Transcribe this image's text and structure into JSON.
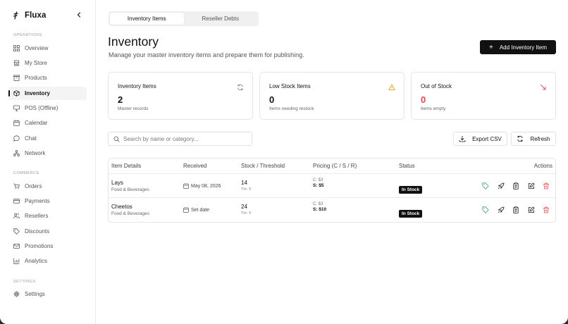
{
  "app": {
    "name": "Fluxa"
  },
  "sidebar": {
    "sections": [
      {
        "label": "OPERATIONS",
        "items": [
          {
            "label": "Overview",
            "icon": "grid-icon"
          },
          {
            "label": "My Store",
            "icon": "store-icon"
          },
          {
            "label": "Products",
            "icon": "box-icon"
          },
          {
            "label": "Inventory",
            "icon": "package-icon",
            "active": true
          },
          {
            "label": "POS (Offline)",
            "icon": "monitor-icon"
          },
          {
            "label": "Calendar",
            "icon": "calendar-icon"
          },
          {
            "label": "Chat",
            "icon": "chat-icon"
          },
          {
            "label": "Network",
            "icon": "network-icon"
          }
        ]
      },
      {
        "label": "COMMERCE",
        "items": [
          {
            "label": "Orders",
            "icon": "cart-icon"
          },
          {
            "label": "Payments",
            "icon": "card-icon"
          },
          {
            "label": "Resellers",
            "icon": "users-icon"
          },
          {
            "label": "Discounts",
            "icon": "tag-icon"
          },
          {
            "label": "Promotions",
            "icon": "mail-icon"
          },
          {
            "label": "Analytics",
            "icon": "chart-icon"
          }
        ]
      },
      {
        "label": "SETTINGS",
        "items": [
          {
            "label": "Settings",
            "icon": "gear-icon"
          }
        ]
      }
    ]
  },
  "tabs": [
    {
      "label": "Inventory Items",
      "active": true
    },
    {
      "label": "Reseller Debts",
      "active": false
    }
  ],
  "header": {
    "title": "Inventory",
    "subtitle": "Manage your master inventory items and prepare them for publishing.",
    "add_button": "Add Inventory Item"
  },
  "stats": [
    {
      "title": "Inventory Items",
      "value": "2",
      "caption": "Master records",
      "icon": "refresh-icon",
      "value_color": "#111111"
    },
    {
      "title": "Low Stock Items",
      "value": "0",
      "caption": "Items needing restock",
      "icon": "warning-icon",
      "value_color": "#111111"
    },
    {
      "title": "Out of Stock",
      "value": "0",
      "caption": "Items empty",
      "icon": "trend-down-icon",
      "value_color": "#e5484d"
    }
  ],
  "toolbar": {
    "search_placeholder": "Search by name or category...",
    "export_label": "Export CSV",
    "refresh_label": "Refresh"
  },
  "table": {
    "columns": [
      "Item Details",
      "Received",
      "Stock / Threshold",
      "Pricing (C / S / R)",
      "Status",
      "Actions"
    ],
    "rows": [
      {
        "name": "Lays",
        "category": "Food & Beverages",
        "received": "May 08, 2026",
        "stock": "14",
        "threshold": "Thr: 5",
        "cost": "C: $3",
        "sell": "S: $5",
        "status": "In Stock"
      },
      {
        "name": "Cheetos",
        "category": "Food & Beverages",
        "received": "Set date",
        "stock": "24",
        "threshold": "Thr: 5",
        "cost": "C: $3",
        "sell": "S: $10",
        "status": "In Stock"
      }
    ]
  },
  "colors": {
    "accent": "#111111",
    "danger": "#e5484d",
    "warning": "#e0a100",
    "success": "#3a9d5d"
  }
}
